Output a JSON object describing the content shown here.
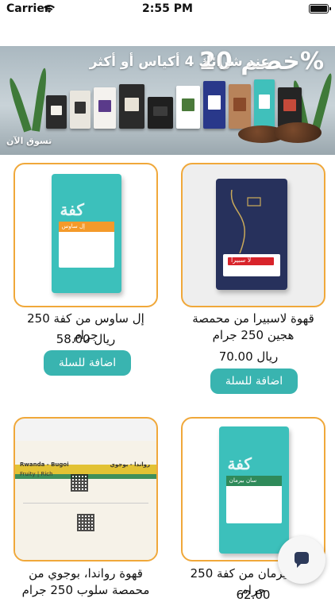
{
  "status_bar": {
    "carrier": "Carrier",
    "time": "2:55 PM"
  },
  "banner": {
    "headline": "عند شرائك 4 أكياس أو أكثر",
    "discount": "خصم 20%",
    "cta": "تسوق الآن"
  },
  "products": [
    {
      "name": "قهوة لاسبيرا من محمصة هجين 250 جرام",
      "price": "70.00 ريال",
      "button": "اضافة للسلة",
      "bag_label": "لا سبيرا"
    },
    {
      "name": "إل ساوس من كفة 250 جرام",
      "price": "58.00 ريال",
      "button": "اضافة للسلة",
      "bag_label": "إل ساوس",
      "brand": "كفة"
    },
    {
      "name": "سان بيرمان من كفة 250 جرام",
      "price": "62.00",
      "bag_label": "سان بيرمان",
      "brand": "كفة"
    },
    {
      "name": "قهوة رواندا، بوجوي من محمصة سلوب 250 جرام",
      "price": "",
      "label_title": "رواندا - بوجوي",
      "label_title_en": "Rwanda - Bugoi",
      "label_notes": "Fruity | Rich"
    }
  ],
  "colors": {
    "accent": "#39b4b0",
    "card_border": "#f0a83a"
  }
}
